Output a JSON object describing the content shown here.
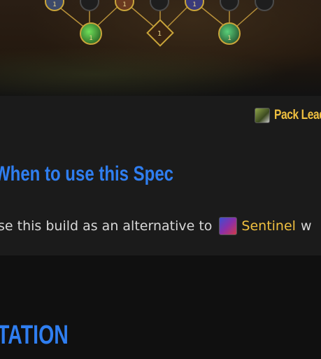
{
  "talent_tree": {
    "icons": [
      "spell-icon",
      "locked-icon",
      "spell-icon",
      "locked-icon",
      "spell-icon",
      "locked-icon",
      "locked-icon",
      "poison-icon",
      "choice-node-icon",
      "nature-icon"
    ],
    "rank_label": "1"
  },
  "hero_talent": {
    "name": "Pack Leader",
    "color": "#f0c040"
  },
  "when_section": {
    "title": "When to use this Spec",
    "text_before": "se this build as an alternative to",
    "link_label": "Sentinel",
    "text_after": "w"
  },
  "rotation_section": {
    "title": "TATION"
  },
  "colors": {
    "heading_blue": "#2f7ef0",
    "gold": "#f0c040",
    "panel_bg": "#1b1b1b",
    "page_bg": "#101010"
  }
}
